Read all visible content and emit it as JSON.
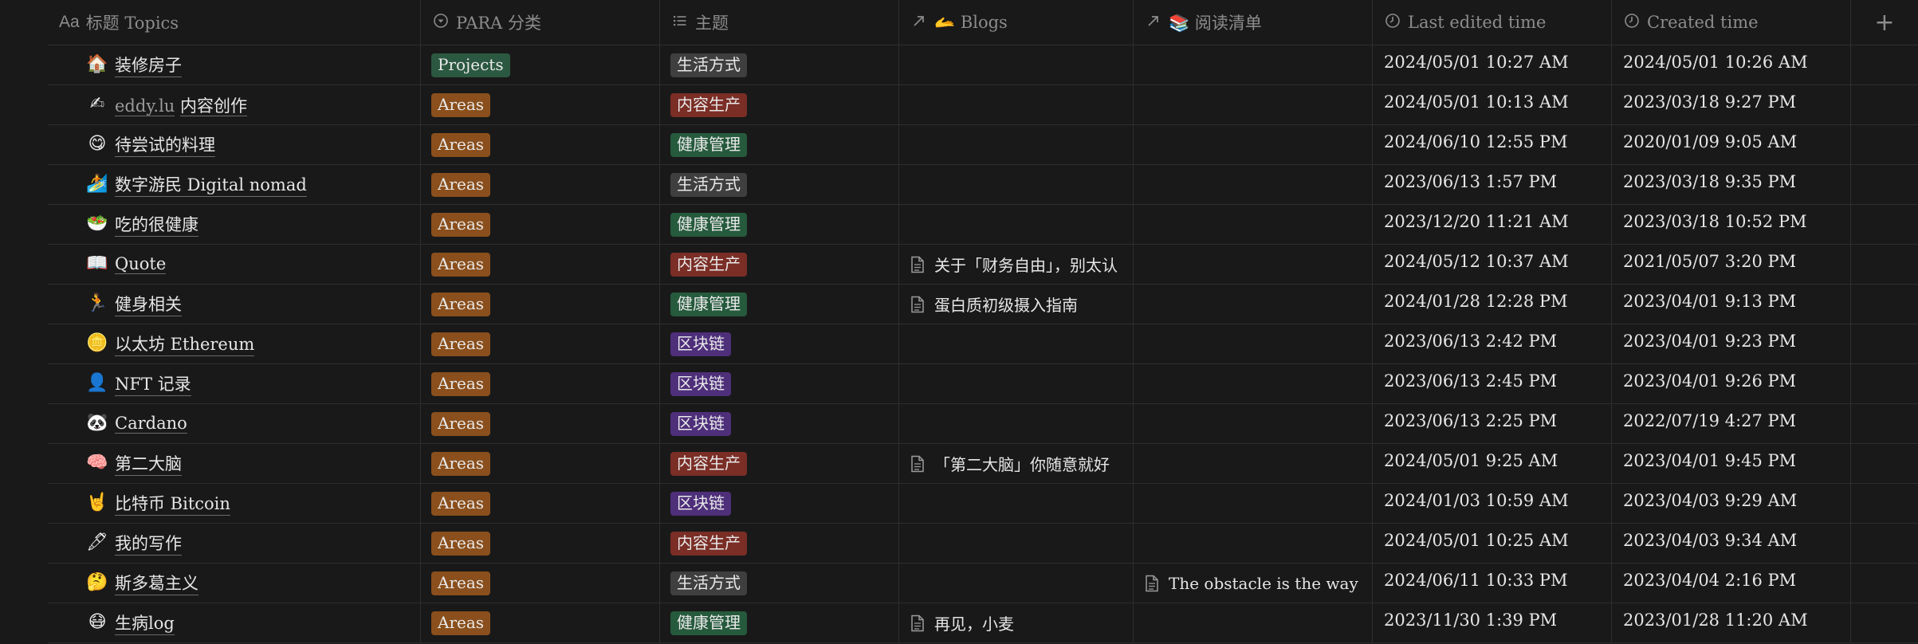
{
  "colors": {
    "background": "#191919",
    "tag_projects": "#2b5840",
    "tag_areas": "#8a4f1c",
    "tag_lifestyle": "#3f3f3f",
    "tag_content": "#7a2e26",
    "tag_health": "#265a3d",
    "tag_blockchain": "#4e2f7a"
  },
  "headers": [
    {
      "label": "标题 Topics",
      "icon": "text-aa-icon"
    },
    {
      "label": "PARA 分类",
      "icon": "select-circle-icon"
    },
    {
      "label": "主题",
      "icon": "multi-select-list-icon"
    },
    {
      "label": "🫴 Blogs",
      "icon": "relation-arrow-icon"
    },
    {
      "label": "📚 阅读清单",
      "icon": "relation-arrow-icon"
    },
    {
      "label": "Last edited time",
      "icon": "clock-icon"
    },
    {
      "label": "Created time",
      "icon": "clock-icon"
    }
  ],
  "add_column_label": "+",
  "rows": [
    {
      "emoji": "🏠",
      "emoji_name": "house-icon",
      "title_a": "装修房子",
      "title_b": "",
      "para": "Projects",
      "topic": "生活方式",
      "blog": "",
      "reading": "",
      "edited": "2024/05/01 10:27 AM",
      "created": "2024/05/01 10:26 AM"
    },
    {
      "emoji": "✍",
      "emoji_name": "writing-hand-icon",
      "title_a": "eddy.lu",
      "title_b": "内容创作",
      "para": "Areas",
      "topic": "内容生产",
      "blog": "",
      "reading": "",
      "edited": "2024/05/01 10:13 AM",
      "created": "2023/03/18 9:27 PM"
    },
    {
      "emoji": "😋",
      "emoji_name": "yum-face-icon",
      "title_a": "待尝试的料理",
      "title_b": "",
      "para": "Areas",
      "topic": "健康管理",
      "blog": "",
      "reading": "",
      "edited": "2024/06/10 12:55 PM",
      "created": "2020/01/09 9:05 AM"
    },
    {
      "emoji": "🏄",
      "emoji_name": "surfer-icon",
      "title_a": "数字游民 Digital nomad",
      "title_b": "",
      "para": "Areas",
      "topic": "生活方式",
      "blog": "",
      "reading": "",
      "edited": "2023/06/13 1:57 PM",
      "created": "2023/03/18 9:35 PM"
    },
    {
      "emoji": "🥗",
      "emoji_name": "salad-icon",
      "title_a": "吃的很健康",
      "title_b": "",
      "para": "Areas",
      "topic": "健康管理",
      "blog": "",
      "reading": "",
      "edited": "2023/12/20 11:21 AM",
      "created": "2023/03/18 10:52 PM"
    },
    {
      "emoji": "📖",
      "emoji_name": "open-book-icon",
      "title_a": "Quote",
      "title_b": "",
      "para": "Areas",
      "topic": "内容生产",
      "blog": "关于「财务自由」，别太认",
      "reading": "",
      "edited": "2024/05/12 10:37 AM",
      "created": "2021/05/07 3:20 PM"
    },
    {
      "emoji": "🏃",
      "emoji_name": "runner-icon",
      "title_a": "健身相关",
      "title_b": "",
      "para": "Areas",
      "topic": "健康管理",
      "blog": "蛋白质初级摄入指南",
      "reading": "",
      "edited": "2024/01/28 12:28 PM",
      "created": "2023/04/01 9:13 PM"
    },
    {
      "emoji": "🪙",
      "emoji_name": "coin-icon",
      "title_a": "以太坊 Ethereum",
      "title_b": "",
      "para": "Areas",
      "topic": "区块链",
      "blog": "",
      "reading": "",
      "edited": "2023/06/13 2:42 PM",
      "created": "2023/04/01 9:23 PM"
    },
    {
      "emoji": "👤",
      "emoji_name": "bust-silhouette-icon",
      "title_a": "NFT 记录",
      "title_b": "",
      "para": "Areas",
      "topic": "区块链",
      "blog": "",
      "reading": "",
      "edited": "2023/06/13 2:45 PM",
      "created": "2023/04/01 9:26 PM"
    },
    {
      "emoji": "🐼",
      "emoji_name": "panda-icon",
      "title_a": "Cardano",
      "title_b": "",
      "para": "Areas",
      "topic": "区块链",
      "blog": "",
      "reading": "",
      "edited": "2023/06/13 2:25 PM",
      "created": "2022/07/19 4:27 PM"
    },
    {
      "emoji": "🧠",
      "emoji_name": "brain-icon",
      "title_a": "第二大脑",
      "title_b": "",
      "para": "Areas",
      "topic": "内容生产",
      "blog": "「第二大脑」你随意就好",
      "reading": "",
      "edited": "2024/05/01 9:25 AM",
      "created": "2023/04/01 9:45 PM"
    },
    {
      "emoji": "🤘",
      "emoji_name": "rock-on-hand-icon",
      "title_a": "比特币 Bitcoin",
      "title_b": "",
      "para": "Areas",
      "topic": "区块链",
      "blog": "",
      "reading": "",
      "edited": "2024/01/03 10:59 AM",
      "created": "2023/04/03 9:29 AM"
    },
    {
      "emoji": "🖋",
      "emoji_name": "fountain-pen-icon",
      "title_a": "我的写作",
      "title_b": "",
      "para": "Areas",
      "topic": "内容生产",
      "blog": "",
      "reading": "",
      "edited": "2024/05/01 10:25 AM",
      "created": "2023/04/03 9:34 AM"
    },
    {
      "emoji": "🤔",
      "emoji_name": "thinking-face-icon",
      "title_a": "斯多葛主义",
      "title_b": "",
      "para": "Areas",
      "topic": "生活方式",
      "blog": "",
      "reading": "The obstacle is the way",
      "edited": "2024/06/11 10:33 PM",
      "created": "2023/04/04 2:16 PM"
    },
    {
      "emoji": "😷",
      "emoji_name": "sick-face-icon",
      "title_a": "生病log",
      "title_b": "",
      "para": "Areas",
      "topic": "健康管理",
      "blog": "再见，小麦",
      "reading": "",
      "edited": "2023/11/30 1:39 PM",
      "created": "2023/01/28 11:20 AM"
    }
  ]
}
